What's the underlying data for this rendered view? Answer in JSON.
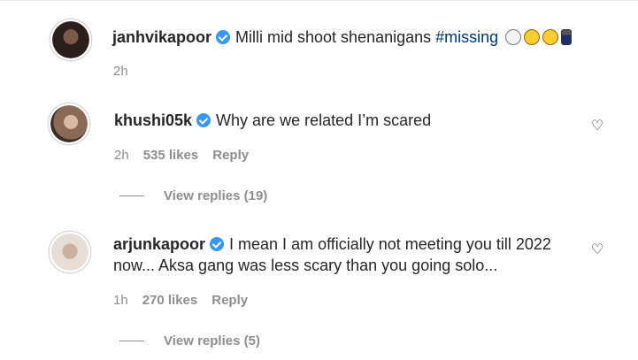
{
  "caption": {
    "username": "janhvikapoor",
    "text": "Milli mid shoot shenanigans",
    "hashtag": "#missing",
    "emojis": [
      "clown-face",
      "smiling-face-with-heart-eyes",
      "smirking-face",
      "person-in-suit"
    ],
    "time": "2h"
  },
  "comments": [
    {
      "username": "khushi05k",
      "text": "Why are we related I’m scared",
      "time": "2h",
      "likes": "535 likes",
      "reply_label": "Reply",
      "view_replies": "View replies (19)"
    },
    {
      "username": "arjunkapoor",
      "text_line1": "I mean I am officially not meeting you till 2022",
      "text_line2": "now... Aksa gang was less scary than you going solo...",
      "time": "1h",
      "likes": "270 likes",
      "reply_label": "Reply",
      "view_replies": "View replies (5)"
    }
  ],
  "colors": {
    "verified": "#3897f0",
    "hashtag": "#00376b",
    "meta_gray": "#8e8e8e",
    "text": "#262626"
  }
}
